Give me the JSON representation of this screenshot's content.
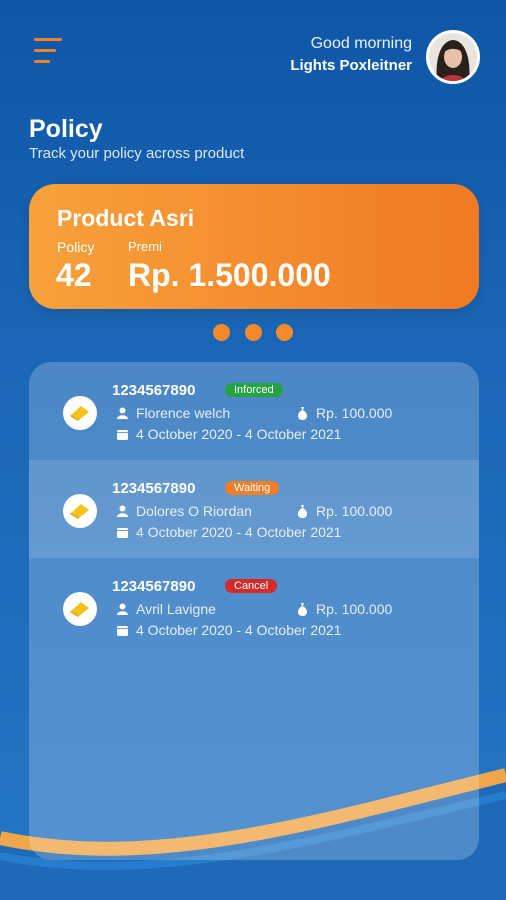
{
  "header": {
    "greeting": "Good morning",
    "user_name": "Lights Poxleitner"
  },
  "page": {
    "title": "Policy",
    "subtitle": "Track your policy across product"
  },
  "product_card": {
    "name": "Product Asri",
    "policy_label": "Policy",
    "premi_label": "Premi",
    "policy_count": "42",
    "premi_value": "Rp. 1.500.000",
    "carousel_dots": 3
  },
  "policies": [
    {
      "number": "1234567890",
      "status": "Inforced",
      "status_color": "#25a244",
      "holder": "Florence welch",
      "amount": "Rp. 100.000",
      "period": "4 October 2020 - 4 October 2021"
    },
    {
      "number": "1234567890",
      "status": "Waiting",
      "status_color": "#f07f2a",
      "holder": "Dolores O Riordan",
      "amount": "Rp. 100.000",
      "period": "4 October 2020 - 4 October 2021"
    },
    {
      "number": "1234567890",
      "status": "Cancel",
      "status_color": "#d42a2a",
      "holder": "Avril Lavigne",
      "amount": "Rp. 100.000",
      "period": "4 October 2020 - 4 October 2021"
    }
  ],
  "colors": {
    "accent": "#f58a2d",
    "background": "#1b66b6"
  }
}
